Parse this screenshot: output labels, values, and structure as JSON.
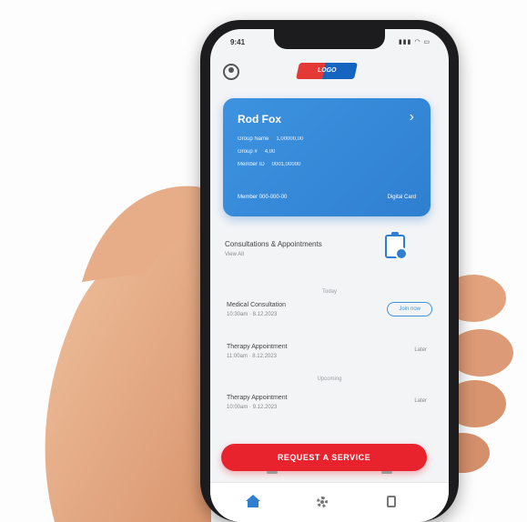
{
  "status_bar": {
    "time": "9:41",
    "icons": "▮▮▮ ◠ ▭"
  },
  "header": {
    "logo_text": "LOGO"
  },
  "card": {
    "name": "Rod Fox",
    "rows": [
      {
        "label": "Group Name",
        "value": "1,00000,00"
      },
      {
        "label": "Group #",
        "value": "4,00"
      },
      {
        "label": "Member ID",
        "value": "0001,00000"
      }
    ],
    "member_label": "Member",
    "member_value": "000-000-00",
    "digital_label": "Digital Card"
  },
  "section": {
    "title": "Consultations & Appointments",
    "subtitle": "View All"
  },
  "dividers": {
    "today": "Today",
    "upcoming": "Upcoming"
  },
  "appointments": [
    {
      "title": "Medical Consultation",
      "datetime": "10:30am · 8.12.2023",
      "status": "Join now",
      "active": true
    },
    {
      "title": "Therapy Appointment",
      "datetime": "11:00am · 8.12.2023",
      "status": "Later",
      "active": false
    },
    {
      "title": "Therapy Appointment",
      "datetime": "10:00am · 9.12.2023",
      "status": "Later",
      "active": false
    }
  ],
  "cta": {
    "label": "REQUEST A SERVICE"
  },
  "colors": {
    "primary": "#2f7fd0",
    "accent": "#e8232d",
    "background": "#f3f4f6"
  },
  "tabs": [
    {
      "icon": "home-icon"
    },
    {
      "icon": "gear-icon"
    },
    {
      "icon": "document-icon"
    }
  ]
}
